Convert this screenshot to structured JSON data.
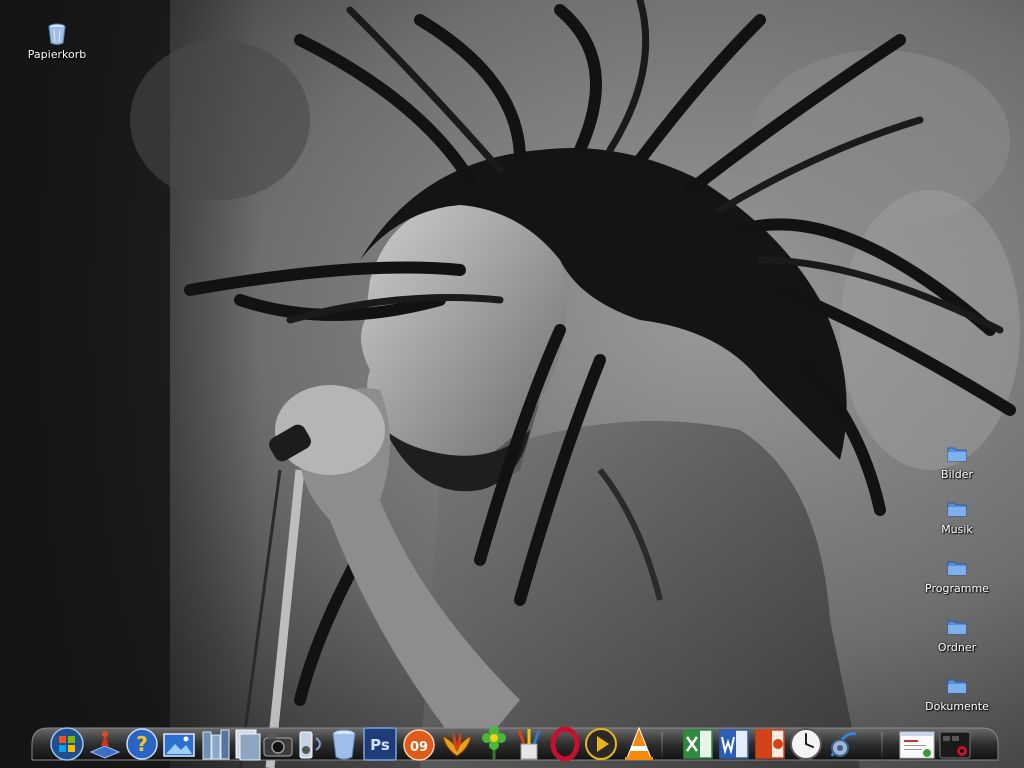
{
  "desktop": {
    "icons": [
      {
        "label": "Papierkorb",
        "icon": "recycle-bin-icon"
      },
      {
        "label": "Bilder",
        "icon": "folder-icon"
      },
      {
        "label": "Musik",
        "icon": "folder-icon"
      },
      {
        "label": "Programme",
        "icon": "folder-icon"
      },
      {
        "label": "Ordner",
        "icon": "folder-icon"
      },
      {
        "label": "Dokumente",
        "icon": "folder-icon"
      }
    ],
    "wallpaper": "black-and-white photo of singer with dreadlocks at microphone"
  },
  "dock": {
    "items": [
      {
        "name": "windows-start-icon"
      },
      {
        "name": "network-icon"
      },
      {
        "name": "help-icon"
      },
      {
        "name": "picture-viewer-icon"
      },
      {
        "name": "books-icon"
      },
      {
        "name": "file-manager-icon"
      },
      {
        "name": "camera-icon"
      },
      {
        "name": "audio-icon"
      },
      {
        "name": "recycle-bin-icon"
      },
      {
        "name": "photoshop-icon",
        "text": "Ps"
      },
      {
        "name": "office-2009-icon",
        "text": "09"
      },
      {
        "name": "flower-icon"
      },
      {
        "name": "green-flower-icon"
      },
      {
        "name": "paint-brushes-icon"
      },
      {
        "name": "opera-icon"
      },
      {
        "name": "media-player-icon"
      },
      {
        "name": "vlc-icon"
      },
      {
        "name": "excel-icon"
      },
      {
        "name": "word-icon"
      },
      {
        "name": "powerpoint-icon"
      },
      {
        "name": "clock-icon"
      },
      {
        "name": "settings-icon"
      },
      {
        "name": "window-preview-icon"
      },
      {
        "name": "media-center-icon"
      }
    ]
  },
  "colors": {
    "folder": "#5a8fd8",
    "dock_bg": "#2a2a2a",
    "office_orange": "#e05a1a",
    "excel_green": "#2e8b3e",
    "word_blue": "#2b5fb4",
    "ppt_orange": "#d2431a",
    "ps_blue": "#1f3c78"
  }
}
